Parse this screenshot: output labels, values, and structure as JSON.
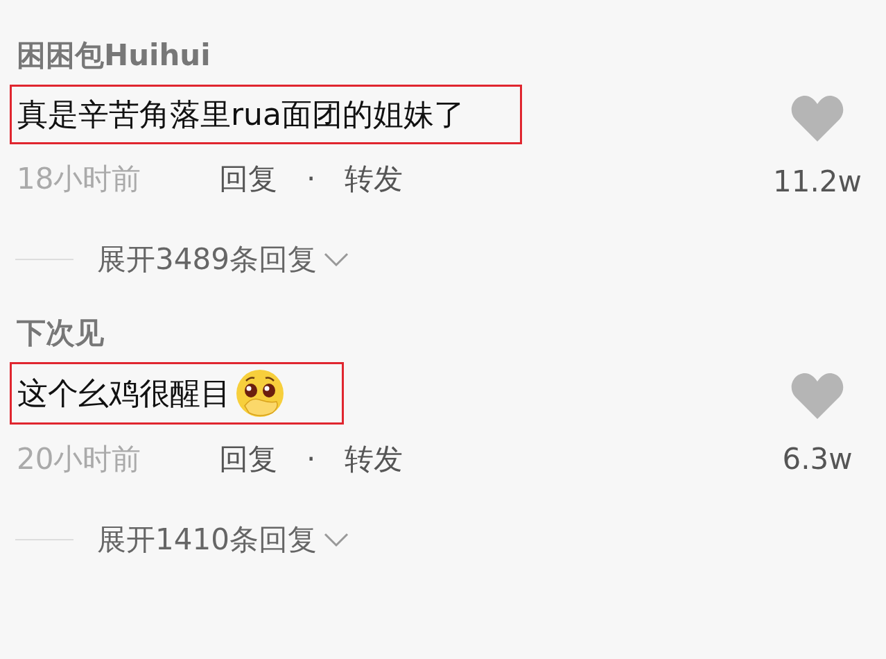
{
  "comments": [
    {
      "username": "困困包Huihui",
      "text": "真是辛苦角落里rua面团的姐妹了",
      "has_emoji": false,
      "highlighted": true,
      "time": "18小时前",
      "reply": "回复",
      "separator": "·",
      "forward": "转发",
      "likes": "11.2w",
      "liked": false,
      "expand": "展开3489条回复"
    },
    {
      "username": "下次见",
      "text": "这个幺鸡很醒目",
      "has_emoji": true,
      "highlighted": true,
      "time": "20小时前",
      "reply": "回复",
      "separator": "·",
      "forward": "转发",
      "likes": "6.3w",
      "liked": false,
      "expand": "展开1410条回复"
    }
  ]
}
